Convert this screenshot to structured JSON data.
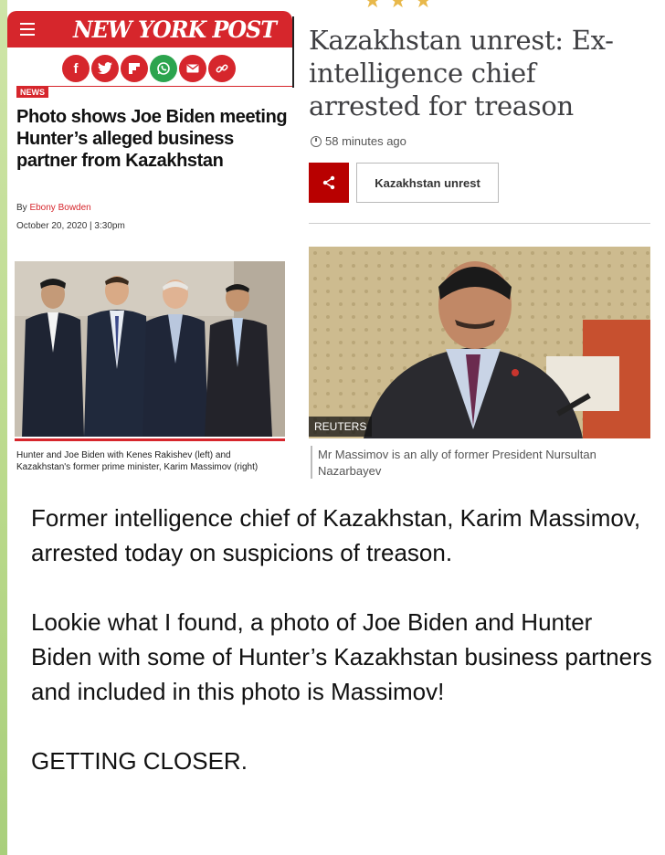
{
  "nypost": {
    "logo": "NEW YORK POST",
    "section_tag": "NEWS",
    "headline": "Photo shows Joe Biden meeting Hunter’s alleged business partner from Kazakhstan",
    "byline_prefix": "By",
    "author": "Ebony Bowden",
    "date": "October 20, 2020 | 3:30pm",
    "caption": "Hunter and Joe Biden with Kenes Rakishev (left) and Kazakhstan's former prime minister, Karim Massimov (right)",
    "share_icons": [
      "facebook-icon",
      "twitter-icon",
      "flipboard-icon",
      "whatsapp-icon",
      "email-icon",
      "link-icon"
    ],
    "brand_color": "#d6262c"
  },
  "bbc": {
    "title": "Kazakhstan unrest: Ex-intelligence chief arrested for treason",
    "time_ago": "58 minutes ago",
    "topic_tag": "Kazakhstan unrest",
    "photo_credit": "REUTERS",
    "caption": "Mr Massimov is an ally of former President Nursultan Nazarbayev",
    "accent_color": "#b80000"
  },
  "message": {
    "paragraphs": [
      "Former intelligence chief of Kazakhstan, Karim Massimov, arrested today on suspicions of treason.",
      "Lookie what I found, a photo of Joe Biden and Hunter Biden with some of Hunter’s Kazakhstan business partners and included in this photo is Massimov!",
      "GETTING CLOSER."
    ]
  }
}
